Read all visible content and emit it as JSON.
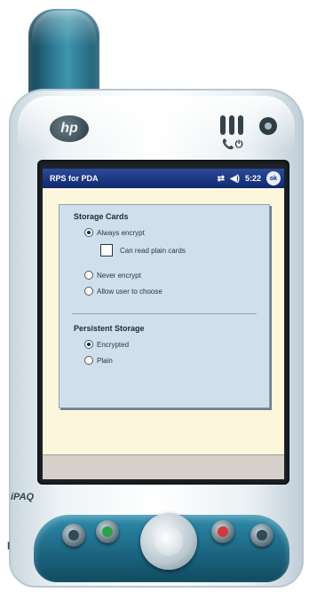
{
  "device": {
    "brand_logo": "hp",
    "model_label": "iPAQ",
    "status_icons_text": "📞⏻",
    "side_mark": "I"
  },
  "screen": {
    "title_bar": {
      "app_title": "RPS for PDA",
      "sync_icon": "⇄",
      "volume_icon": "◀)",
      "time": "5:22",
      "ok_label": "ok"
    },
    "storage_cards": {
      "title": "Storage Cards",
      "options": [
        {
          "label": "Always encrypt",
          "selected": true
        },
        {
          "label": "Never encrypt",
          "selected": false
        },
        {
          "label": "Allow user to choose",
          "selected": false
        }
      ],
      "checkbox": {
        "label": "Can read plain cards",
        "checked": false
      }
    },
    "persistent_storage": {
      "title": "Persistent Storage",
      "options": [
        {
          "label": "Encrypted",
          "selected": true
        },
        {
          "label": "Plain",
          "selected": false
        }
      ]
    }
  },
  "colors": {
    "title_bar": "#0f2a6e",
    "panel": "#cfe0ec",
    "screen_bg": "#fbf6dc",
    "device_accent": "#1c6683"
  },
  "icons": [
    "hp-logo",
    "speaker-grille",
    "power-icon",
    "sync-icon",
    "volume-icon",
    "ok-icon",
    "calendar-button",
    "contacts-button",
    "navigation-pad",
    "inbox-button",
    "home-button"
  ]
}
